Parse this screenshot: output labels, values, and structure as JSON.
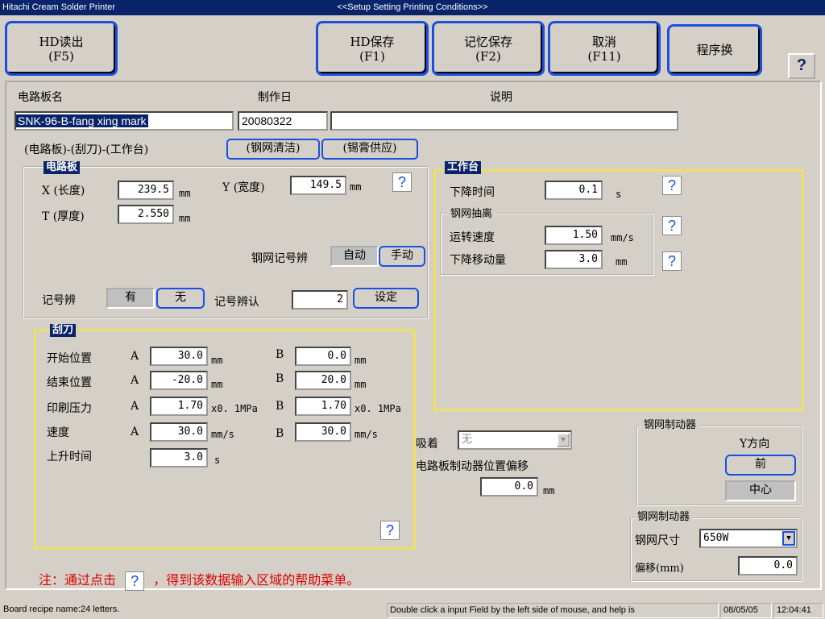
{
  "window": {
    "app_title": "Hitachi Cream Solder Printer",
    "title": "<<Setup Setting Printing Conditions>>"
  },
  "toolbar": {
    "hd_read": [
      "HD读出",
      "(F5)"
    ],
    "hd_save": [
      "HD保存",
      "(F1)"
    ],
    "memory_save": [
      "记忆保存",
      "(F2)"
    ],
    "cancel": [
      "取消",
      "(F11)"
    ],
    "program_switch": "程序换",
    "help": "?"
  },
  "header": {
    "board_name_label": "电路板名",
    "date_label": "制作日",
    "desc_label": "说明",
    "board_name_value": "SNK-96-B-fang xing mark",
    "date_value": "20080322",
    "desc_value": ""
  },
  "tabs": {
    "main_label": "(电路板)-(刮刀)-(工作台)",
    "stencil_clean": "(钢网清洁)",
    "solder_supply": "(锡膏供应)"
  },
  "board_group": {
    "title": "电路板",
    "x_label": "X (长度)",
    "x_value": "239.5",
    "y_label": "Y (宽度)",
    "y_value": "149.5",
    "t_label": "T (厚度)",
    "t_value": "2.550",
    "unit_mm": "mm",
    "stencil_mark_label": "钢网记号辨",
    "auto": "自动",
    "manual": "手动",
    "mark_label": "记号辨",
    "mark_yes": "有",
    "mark_no": "无",
    "mark_recog_label": "记号辨认",
    "mark_recog_value": "2",
    "set_button": "设定",
    "help": "?"
  },
  "squeegee": {
    "title": "刮刀",
    "rows": [
      {
        "label": "开始位置",
        "a": "30.0",
        "a_unit": "mm",
        "b": "0.0",
        "b_unit": "mm"
      },
      {
        "label": "结束位置",
        "a": "-20.0",
        "a_unit": "mm",
        "b": "20.0",
        "b_unit": "mm"
      },
      {
        "label": "印刷压力",
        "a": "1.70",
        "a_unit": "x0. 1MPa",
        "b": "1.70",
        "b_unit": "x0. 1MPa"
      },
      {
        "label": "速度",
        "a": "30.0",
        "a_unit": "mm/s",
        "b": "30.0",
        "b_unit": "mm/s"
      }
    ],
    "a": "A",
    "b": "B",
    "rise_label": "上升时间",
    "rise_value": "3.0",
    "rise_unit": "s",
    "help": "?"
  },
  "table_group": {
    "title": "工作台",
    "down_time_label": "下降时间",
    "down_time_value": "0.1",
    "down_time_unit": "s",
    "separation_title": "钢网抽离",
    "speed_label": "运转速度",
    "speed_value": "1.50",
    "speed_unit": "mm/s",
    "down_move_label": "下降移动量",
    "down_move_value": "3.0",
    "down_move_unit": "mm",
    "help": "?"
  },
  "suction": {
    "label": "吸着",
    "value": "无",
    "offset_label": "电路板制动器位置偏移",
    "offset_value": "0.0",
    "offset_unit": "mm"
  },
  "stopper1": {
    "title": "钢网制动器",
    "y_dir": "Y方向",
    "front": "前",
    "center": "中心"
  },
  "stopper2": {
    "title": "钢网制动器",
    "size_label": "钢网尺寸",
    "size_value": "650W",
    "offset_label": "偏移(mm)",
    "offset_value": "0.0"
  },
  "note": {
    "prefix": "注：通过点击",
    "icon": "?",
    "suffix": "，得到该数据输入区域的帮助菜单。"
  },
  "statusbar": {
    "left": "Board recipe name:24 letters.",
    "middle": "Double click a input Field by the left side of mouse, and help is",
    "date": "08/05/05",
    "time": "12:04:41"
  },
  "colors": {
    "accent_blue": "#1a4fe0",
    "title_navy": "#0a246a",
    "group_yellow": "#f0e060",
    "note_red": "#e00000"
  }
}
